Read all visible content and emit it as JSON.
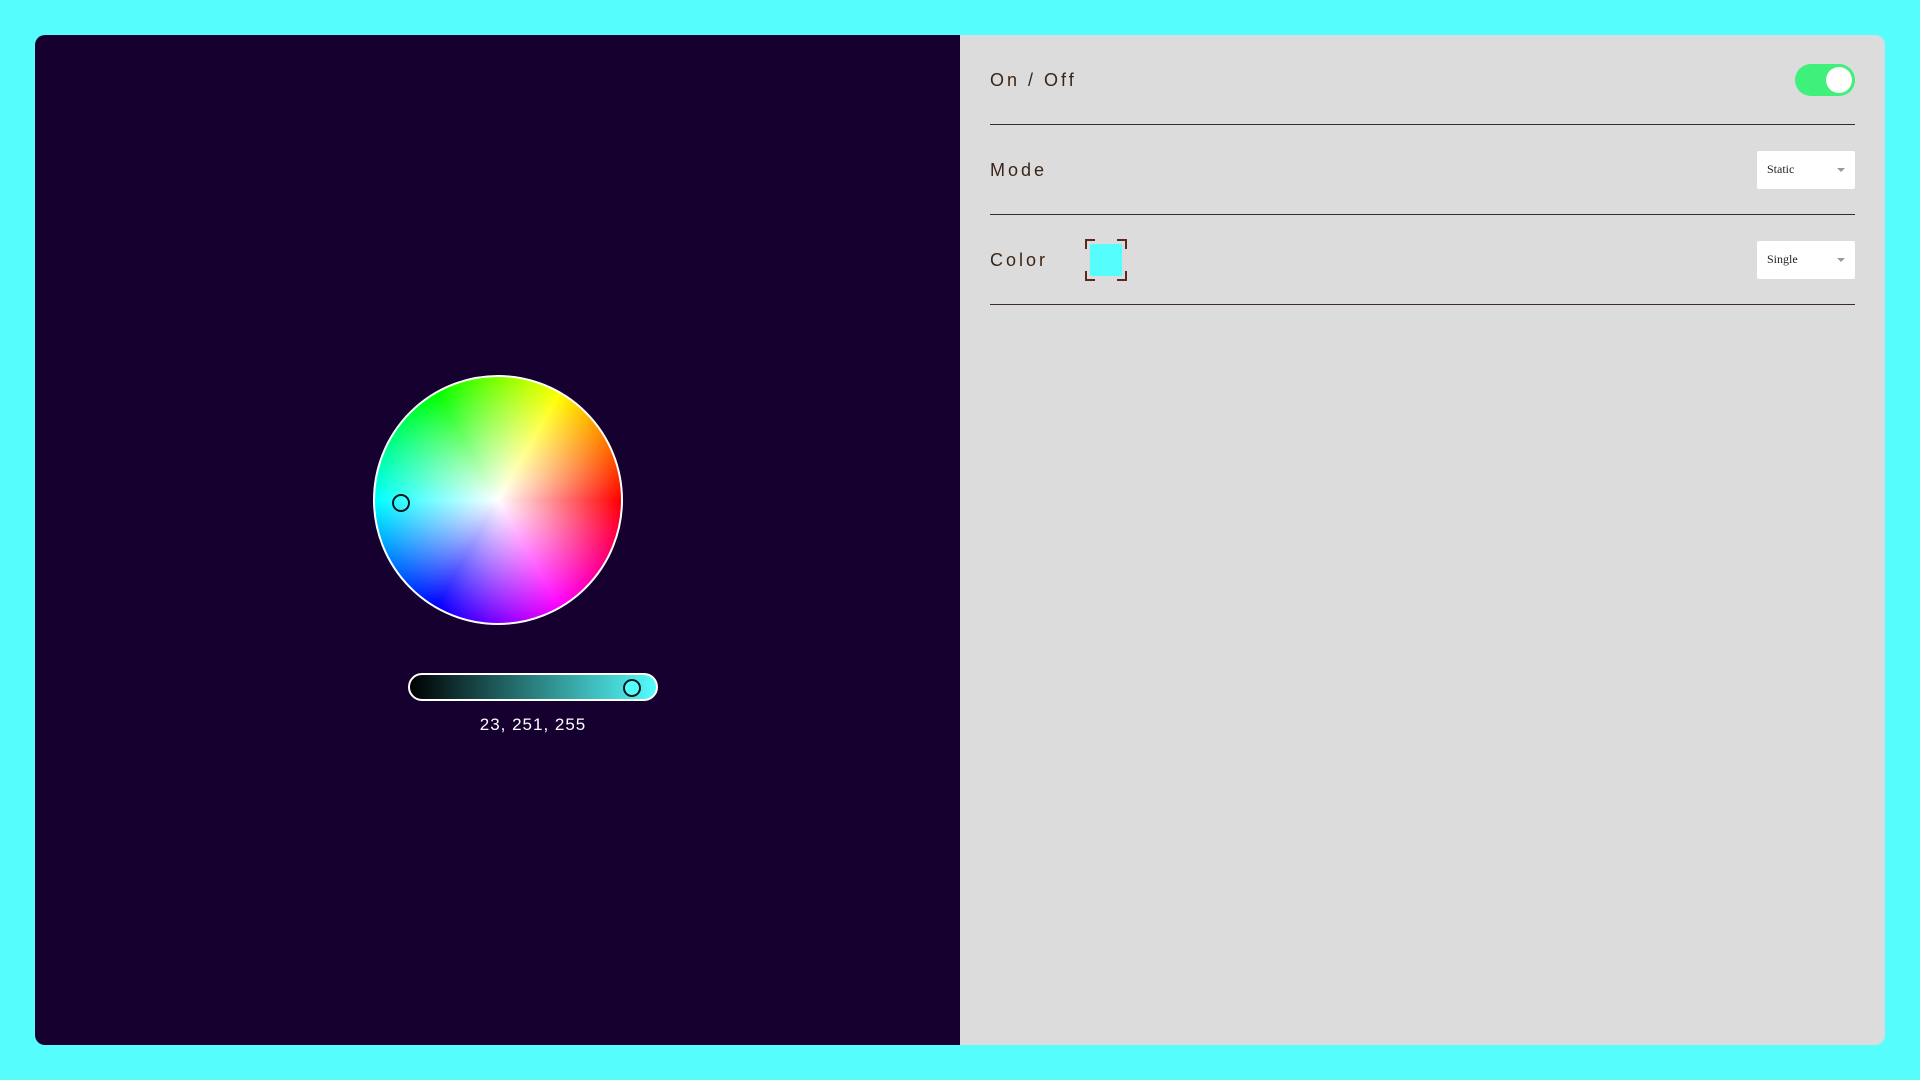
{
  "picker": {
    "rgb_text": "23, 251, 255",
    "brightness": 0.95,
    "selected_color": "#55fdfd"
  },
  "controls": {
    "power": {
      "label": "On / Off",
      "on": true,
      "on_color": "#3ff07a"
    },
    "mode": {
      "label": "Mode",
      "selected": "Static"
    },
    "color": {
      "label": "Color",
      "swatch_color": "#55fdfd",
      "type_selected": "Single"
    }
  },
  "theme": {
    "background": "#55fdfd",
    "left_panel": "#150030",
    "right_panel": "#dcdcdc"
  }
}
